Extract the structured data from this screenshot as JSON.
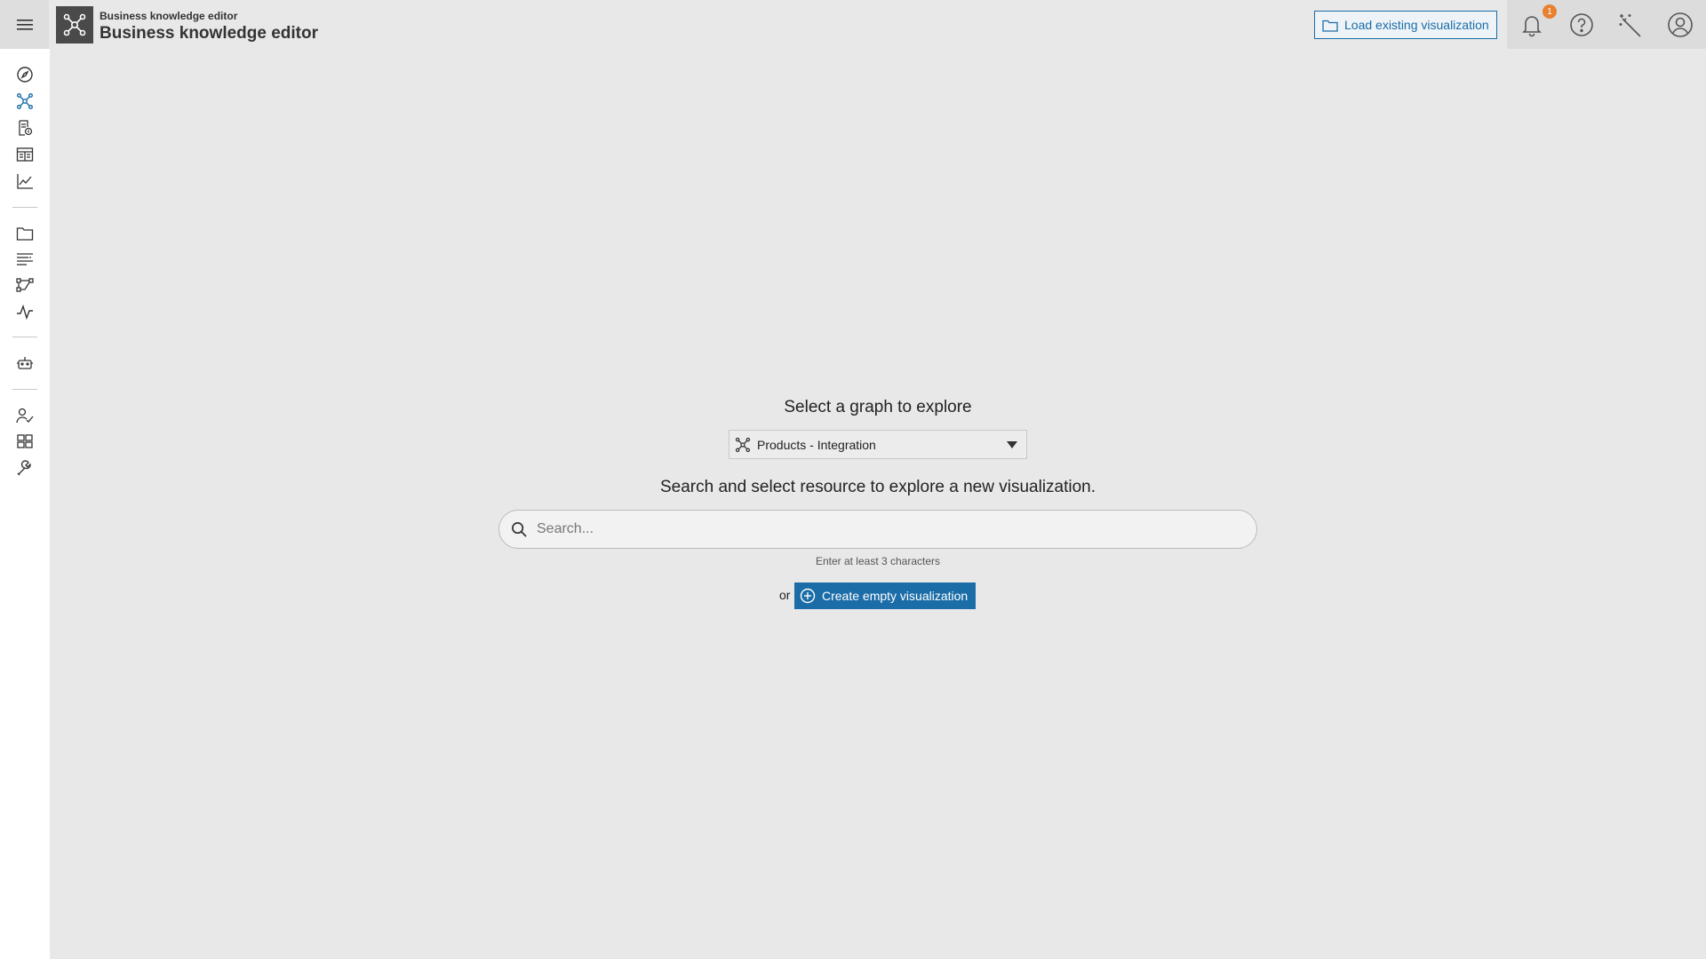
{
  "header": {
    "app_subtitle": "Business knowledge editor",
    "app_title": "Business knowledge editor",
    "load_button_label": "Load existing visualization",
    "notification_count": "1",
    "icons": [
      "menu-icon",
      "graph-logo-icon",
      "folder-icon",
      "bell-icon",
      "help-icon",
      "magic-wand-icon",
      "user-icon"
    ]
  },
  "sidebar": {
    "items": [
      {
        "icon": "compass-icon"
      },
      {
        "icon": "graph-icon",
        "active": true
      },
      {
        "icon": "dataset-icon"
      },
      {
        "icon": "table-icon"
      },
      {
        "icon": "line-chart-icon"
      },
      {
        "icon": "folder-icon"
      },
      {
        "icon": "list-filter-icon"
      },
      {
        "icon": "workflow-icon"
      },
      {
        "icon": "pulse-icon"
      },
      {
        "icon": "robot-icon"
      },
      {
        "icon": "user-check-icon"
      },
      {
        "icon": "dashboard-icon"
      },
      {
        "icon": "tools-icon"
      }
    ]
  },
  "main": {
    "select_graph_heading": "Select a graph to explore",
    "selected_graph": "Products - Integration",
    "search_heading": "Search and select resource to explore a new visualization.",
    "search_placeholder": "Search...",
    "search_hint": "Enter at least 3 characters",
    "or_label": "or",
    "create_button_label": "Create empty visualization"
  },
  "colors": {
    "accent": "#1b6da8",
    "badge": "#e8802f",
    "background": "#e8e8e8",
    "sidebar": "#ffffff"
  }
}
